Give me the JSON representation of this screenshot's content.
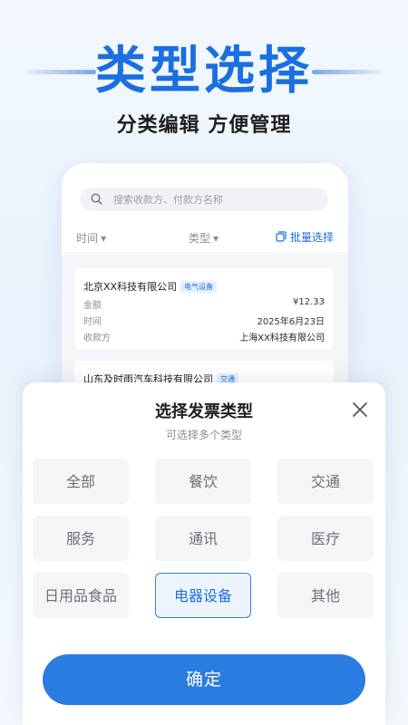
{
  "hero": {
    "title": "类型选择",
    "subtitle": "分类编辑 方便管理"
  },
  "phone": {
    "search": {
      "placeholder": "搜索收款方、付款方名称"
    },
    "filters": [
      {
        "label": "时间"
      },
      {
        "label": "类型"
      }
    ],
    "batch_select": "批量选择",
    "cards": [
      {
        "company": "北京XX科技有限公司",
        "tag": "电气设备",
        "rows": [
          {
            "label": "金额",
            "value": "¥12.33"
          },
          {
            "label": "时间",
            "value": "2025年6月23日"
          },
          {
            "label": "收款方",
            "value": "上海XX科技有限公司"
          }
        ]
      },
      {
        "company": "山东及时雨汽车科技有限公司",
        "tag": "交通"
      }
    ]
  },
  "sheet": {
    "title": "选择发票类型",
    "subtitle": "可选择多个类型",
    "options": [
      {
        "label": "全部",
        "selected": false
      },
      {
        "label": "餐饮",
        "selected": false
      },
      {
        "label": "交通",
        "selected": false
      },
      {
        "label": "服务",
        "selected": false
      },
      {
        "label": "通讯",
        "selected": false
      },
      {
        "label": "医疗",
        "selected": false
      },
      {
        "label": "日用品食品",
        "selected": false
      },
      {
        "label": "电器设备",
        "selected": true
      },
      {
        "label": "其他",
        "selected": false
      }
    ],
    "confirm": "确定"
  },
  "colors": {
    "accent": "#1b6fde",
    "button": "#2b7ce0",
    "option_bg": "#f4f5f7",
    "selected_border": "#2f7ee3"
  },
  "icons": {
    "search": "search-icon",
    "close": "close-icon",
    "batch": "batch-select-icon",
    "caret": "caret-down-icon"
  }
}
